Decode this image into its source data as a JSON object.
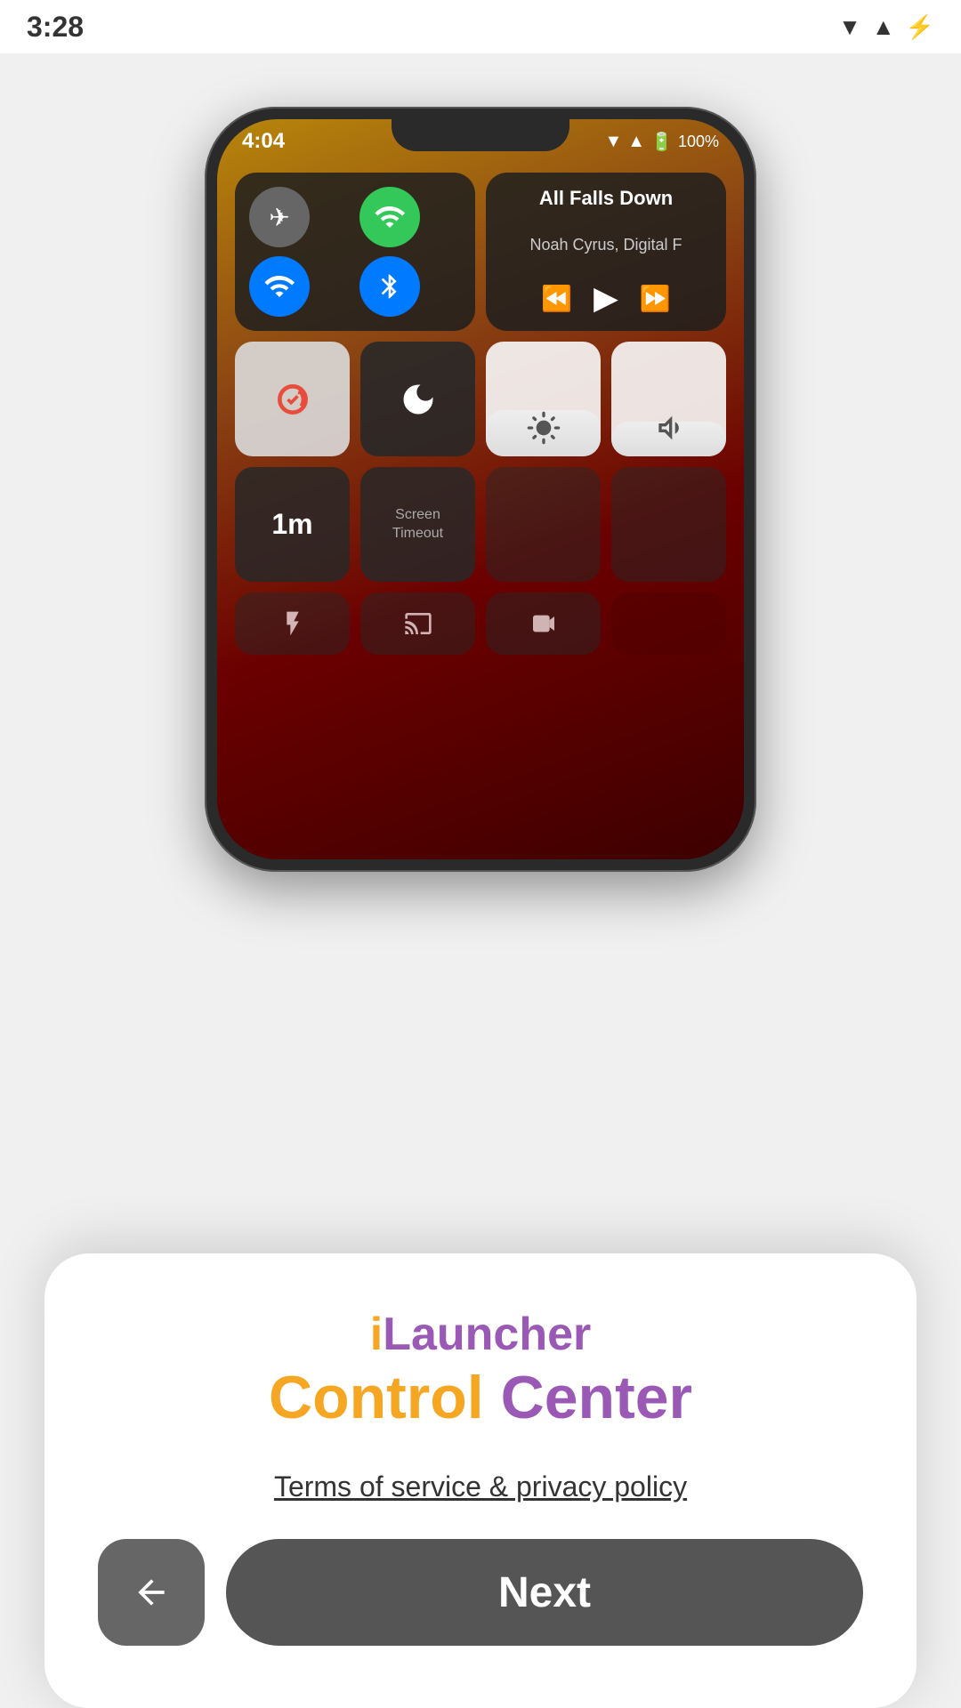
{
  "statusBar": {
    "time": "3:28",
    "icons": [
      "wifi",
      "signal",
      "battery"
    ]
  },
  "phone": {
    "time": "4:04",
    "battery": "100%",
    "controlCenter": {
      "music": {
        "title": "All Falls Down",
        "artist": "Noah Cyrus, Digital F"
      },
      "screenTimeout": {
        "value": "1m",
        "label": "Screen\nTimeout"
      }
    }
  },
  "card": {
    "appName": {
      "prefix": "i",
      "suffix": "Launcher",
      "titleLine1": "iLauncher",
      "titleLine2_part1": "Control",
      "titleLine2_part2": "Center"
    },
    "termsLabel": "Terms of service & privacy policy",
    "backLabel": "←",
    "nextLabel": "Next"
  }
}
